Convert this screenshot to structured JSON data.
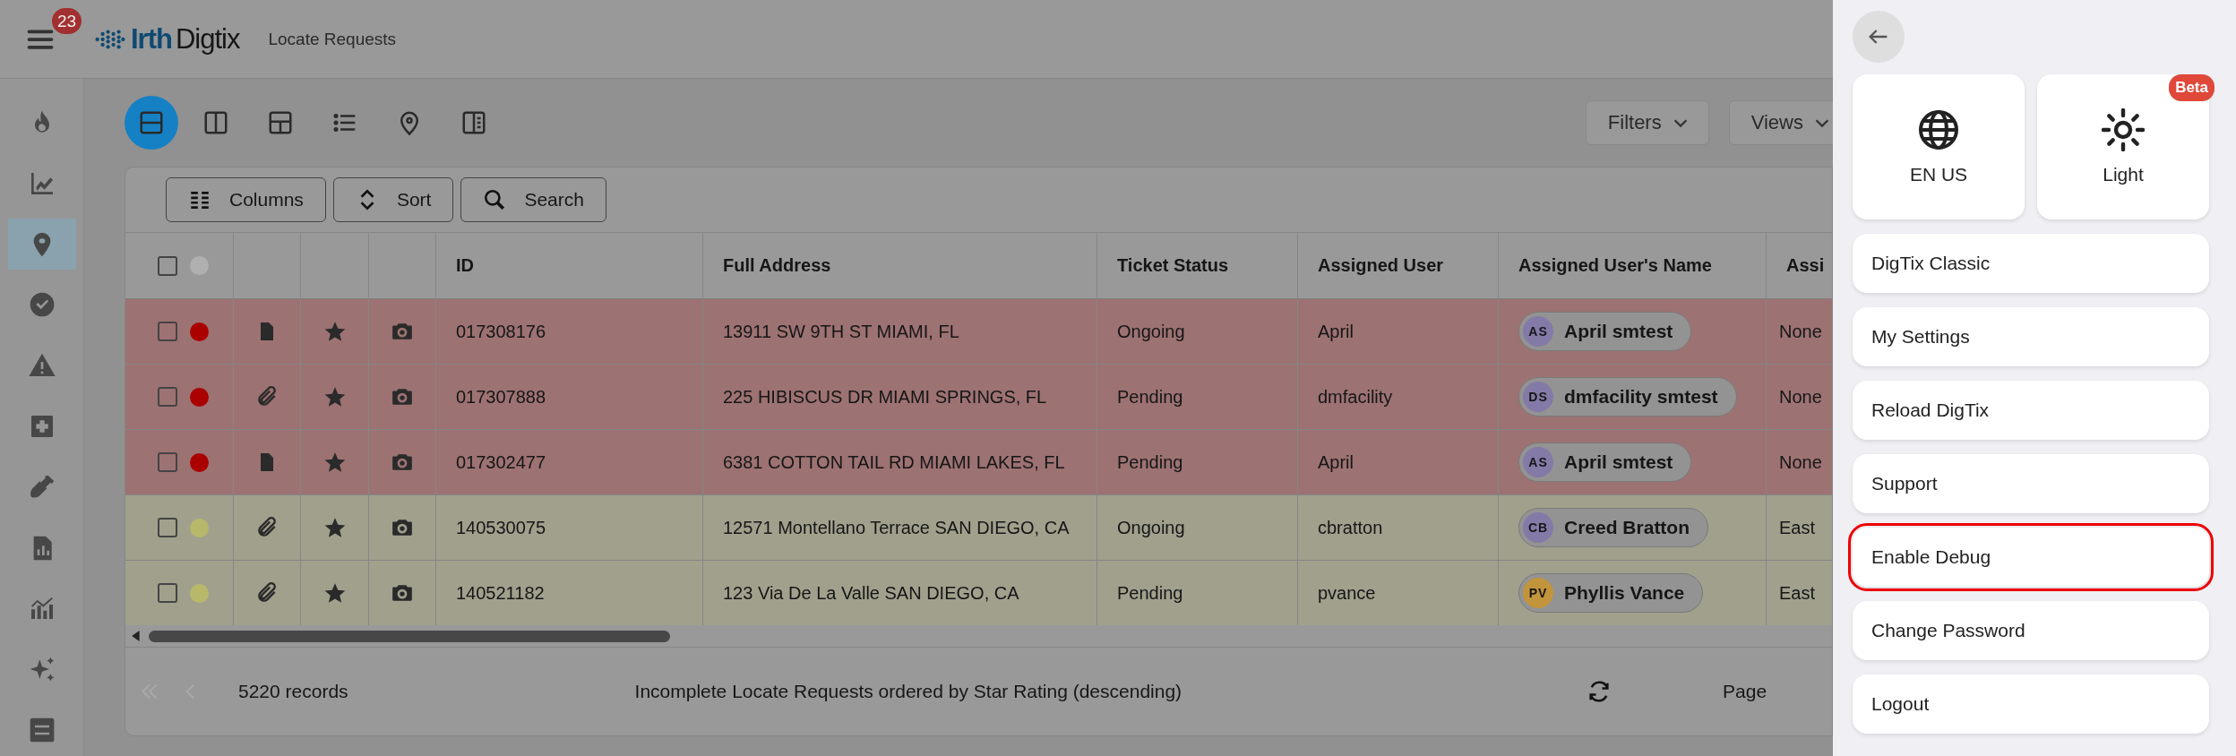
{
  "header": {
    "notification_count": "23",
    "logo": {
      "part_1": "Irth",
      "part_2": "Digtix"
    },
    "title": "Locate Requests"
  },
  "sidebar": {
    "items": [
      {
        "kind": "flame",
        "selected": false
      },
      {
        "kind": "trend",
        "selected": false
      },
      {
        "kind": "pin",
        "selected": true
      },
      {
        "kind": "check",
        "selected": false
      },
      {
        "kind": "warning",
        "selected": false
      },
      {
        "kind": "plus",
        "selected": false
      },
      {
        "kind": "shovel",
        "selected": false
      },
      {
        "kind": "report",
        "selected": false
      },
      {
        "kind": "chart",
        "selected": false
      },
      {
        "kind": "sparkles",
        "selected": false
      },
      {
        "kind": "sliders",
        "selected": false
      }
    ]
  },
  "view_modes": [
    {
      "kind": "split-rows",
      "selected": true
    },
    {
      "kind": "split-columns",
      "selected": false
    },
    {
      "kind": "layout",
      "selected": false
    },
    {
      "kind": "list",
      "selected": false
    },
    {
      "kind": "pin",
      "selected": false
    },
    {
      "kind": "side-panel",
      "selected": false
    }
  ],
  "filters": {
    "filters_label": "Filters",
    "views_label": "Views"
  },
  "table_tools": [
    {
      "kind": "columns",
      "label": "Columns"
    },
    {
      "kind": "sort",
      "label": "Sort"
    },
    {
      "kind": "search",
      "label": "Search"
    }
  ],
  "table": {
    "header_checked": false,
    "columns": [
      "ID",
      "Full Address",
      "Ticket Status",
      "Assigned User",
      "Assigned User's Name",
      "Assi"
    ],
    "rows": [
      {
        "checked": false,
        "color": "#aa0000",
        "attachment": {
          "kind": "document"
        },
        "id": "017308176",
        "address": "13911 SW 9TH ST MIAMI, FL",
        "status": "Ongoing",
        "user": "April",
        "avatar": {
          "initials": "AS",
          "color": "#847aa8"
        },
        "user_name": "April smtest",
        "column_10": "None"
      },
      {
        "checked": false,
        "color": "#aa0000",
        "attachment": {
          "kind": "clip"
        },
        "id": "017307888",
        "address": "225 HIBISCUS DR MIAMI SPRINGS, FL",
        "status": "Pending",
        "user": "dmfacility",
        "avatar": {
          "initials": "DS",
          "color": "#847aa8"
        },
        "user_name": "dmfacility smtest",
        "column_10": "None"
      },
      {
        "checked": false,
        "color": "#aa0000",
        "attachment": {
          "kind": "document"
        },
        "id": "017302477",
        "address": "6381 COTTON TAIL RD MIAMI LAKES, FL",
        "status": "Pending",
        "user": "April",
        "avatar": {
          "initials": "AS",
          "color": "#847aa8"
        },
        "user_name": "April smtest",
        "column_10": "None"
      },
      {
        "checked": false,
        "color": "#b8b86a",
        "attachment": {
          "kind": "clip"
        },
        "id": "140530075",
        "address": "12571 Montellano Terrace SAN DIEGO, CA",
        "status": "Ongoing",
        "user": "cbratton",
        "avatar": {
          "initials": "CB",
          "color": "#847aa8"
        },
        "user_name": "Creed Bratton",
        "column_10": "East"
      },
      {
        "checked": false,
        "color": "#b8b86a",
        "attachment": {
          "kind": "clip"
        },
        "id": "140521182",
        "address": "123 Via De La Valle SAN DIEGO, CA",
        "status": "Pending",
        "user": "pvance",
        "avatar": {
          "initials": "PV",
          "color": "#c2943c"
        },
        "user_name": "Phyllis Vance",
        "column_10": "East"
      }
    ]
  },
  "footer": {
    "records": "5220 records",
    "description": "Incomplete Locate Requests ordered by Star Rating (descending)",
    "page": "Page"
  },
  "menu": {
    "tiles": [
      {
        "kind": "language",
        "label": "EN US"
      },
      {
        "kind": "theme",
        "label": "Light",
        "badge": "Beta"
      }
    ],
    "items": [
      {
        "label": "DigTix Classic",
        "highlighted": false
      },
      {
        "label": "My Settings",
        "highlighted": false
      },
      {
        "label": "Reload DigTix",
        "highlighted": false
      },
      {
        "label": "Support",
        "highlighted": false
      },
      {
        "label": "Enable Debug",
        "highlighted": true
      },
      {
        "label": "Change Password",
        "highlighted": false
      },
      {
        "label": "Logout",
        "highlighted": false
      }
    ]
  }
}
